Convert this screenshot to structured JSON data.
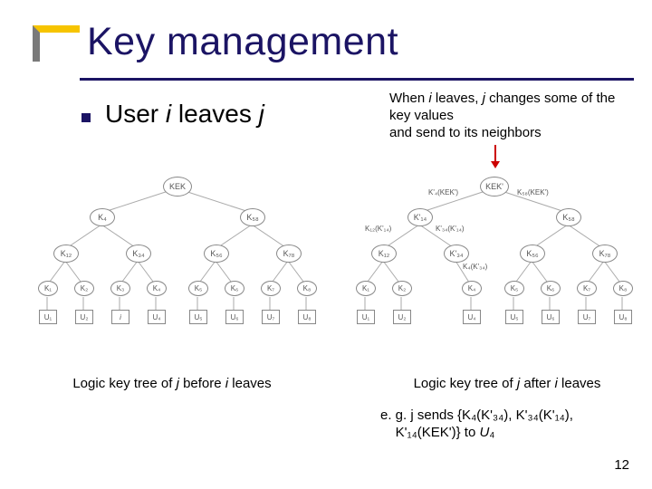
{
  "title": "Key management",
  "bullet_pre": "User ",
  "bullet_i": "i",
  "bullet_mid": " leaves ",
  "bullet_j": "j",
  "note_pre": "When ",
  "note_i": "i",
  "note_mid1": " leaves, ",
  "note_j": "j",
  "note_rest": " changes some of the key values",
  "note_line2": "and send to its neighbors",
  "left_tree": {
    "root": "KEK",
    "L1": [
      "K₄",
      "K₅₈"
    ],
    "L2": [
      "K₁₂",
      "K₃₄",
      "K₅₆",
      "K₇₈"
    ],
    "L3": [
      "K₁",
      "K₂",
      "K₃",
      "K₄",
      "K₅",
      "K₆",
      "K₇",
      "K₈"
    ],
    "leaves": [
      "U₁",
      "U₂",
      "i",
      "U₄",
      "U₅",
      "U₆",
      "U₇",
      "U₈"
    ]
  },
  "right_tree": {
    "root": "KEK'",
    "root_elabel": "K'₄(KEK')",
    "root_elabel_r": "K₅₈(KEK')",
    "L1": [
      "K'₁₄",
      "K₅₈"
    ],
    "L1_elabels": [
      "K₁₂(K'₁₄)",
      "K'₃₄(K'₁₄)"
    ],
    "L2": [
      "K₁₂",
      "K'₃₄",
      "K₅₆",
      "K₇₈"
    ],
    "L2_elabel": "K₄(K'₃₄)",
    "L3": [
      "K₁",
      "K₂",
      "",
      "K₄",
      "K₅",
      "K₆",
      "K₇",
      "K₈"
    ],
    "leaves": [
      "U₁",
      "U₂",
      "",
      "U₄",
      "U₅",
      "U₆",
      "U₇",
      "U₈"
    ]
  },
  "caption_left_pre": "Logic key tree of ",
  "caption_left_j": "j",
  "caption_left_mid": " before ",
  "caption_left_i": "i",
  "caption_left_end": " leaves",
  "caption_right_pre": "Logic key tree of ",
  "caption_right_j": "j",
  "caption_right_mid": " after ",
  "caption_right_i": "i",
  "caption_right_end": " leaves",
  "example_l1": "e. g. j sends {K₄(K'₃₄), K'₃₄(K'₁₄),",
  "example_l2a": "K'₁₄(KEK')} to ",
  "example_l2b": "U",
  "example_l2c": "₄",
  "pagenum": "12"
}
